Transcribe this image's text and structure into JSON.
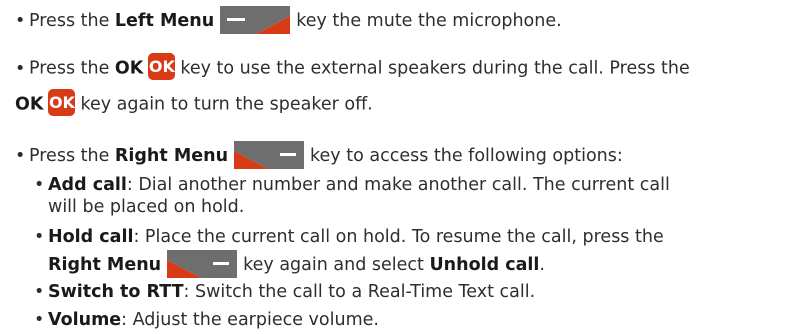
{
  "colors": {
    "text": "#2e2e2e",
    "key_red": "#d93a16",
    "menu_key_gray": "#6e6e6e"
  },
  "items": {
    "left_menu": {
      "pre": "Press the ",
      "bold": "Left Menu",
      "post": "key the mute the microphone.",
      "key_icon": "left-menu-key-icon"
    },
    "ok": {
      "pre": "Press the ",
      "bold": "OK",
      "key_label": "OK",
      "post1": "key to use the external speakers during the call. Press the",
      "bold2": "OK",
      "key_label2": "OK",
      "post2": "key again to turn the speaker off."
    },
    "right_menu": {
      "pre": "Press the ",
      "bold": "Right Menu",
      "post": "key to access the following options:",
      "key_icon": "right-menu-key-icon"
    }
  },
  "options": {
    "add_call": {
      "bold": "Add call",
      "text1": ": Dial another number and make another call. The current call",
      "text2": "will be placed on hold."
    },
    "hold_call": {
      "bold": "Hold call",
      "text1": ": Place the current call on hold. To resume the call, press the",
      "bold2": "Right Menu",
      "text2": "key again and select ",
      "bold3": "Unhold call",
      "text3": "."
    },
    "switch_rtt": {
      "bold": "Switch to RTT",
      "text": ": Switch the call to a Real-Time Text call."
    },
    "volume": {
      "bold": "Volume",
      "text": ": Adjust the earpiece volume."
    }
  }
}
